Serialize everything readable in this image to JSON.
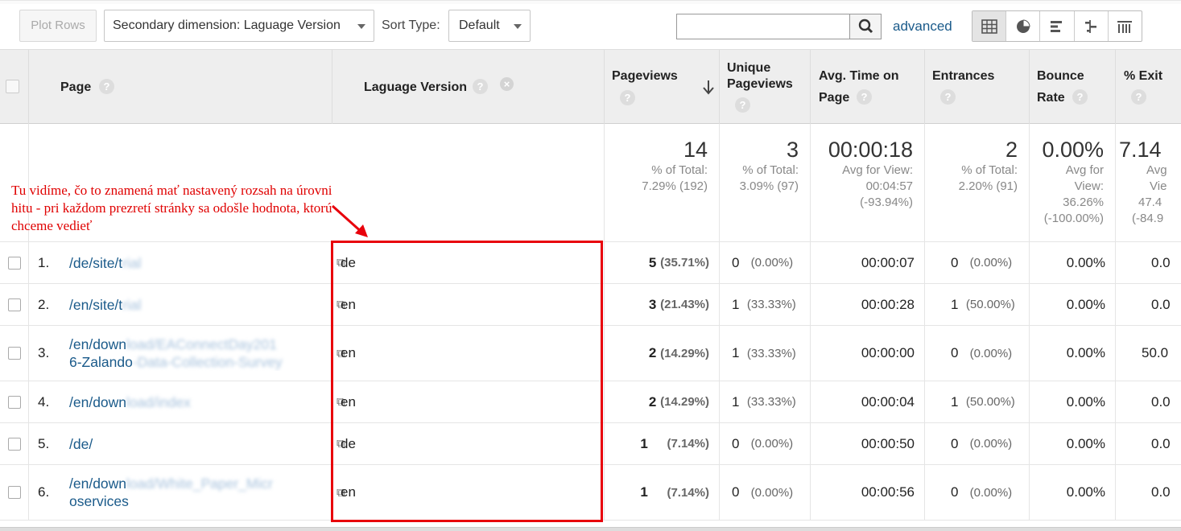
{
  "toolbar": {
    "plot_rows": "Plot Rows",
    "secondary_dimension": "Secondary dimension: Laguage Version",
    "sort_type_label": "Sort Type:",
    "sort_type_value": "Default",
    "search_value": "",
    "advanced": "advanced",
    "view_icons": [
      "table-grid-icon",
      "pie-chart-icon",
      "bar-performance-icon",
      "comparison-icon",
      "pivot-icon"
    ]
  },
  "columns": {
    "page": "Page",
    "language": "Laguage Version",
    "pageviews": "Pageviews",
    "unique_l1": "Unique",
    "unique_l2": "Pageviews",
    "avg_time_l1": "Avg. Time on",
    "avg_time_l2": "Page",
    "entrances": "Entrances",
    "bounce_l1": "Bounce",
    "bounce_l2": "Rate",
    "exit": "% Exit",
    "help": "?"
  },
  "totals": {
    "pageviews": {
      "value": "14",
      "l1": "% of Total:",
      "l2": "7.29% (192)"
    },
    "unique": {
      "value": "3",
      "l1": "% of Total:",
      "l2": "3.09% (97)"
    },
    "avg_time": {
      "value": "00:00:18",
      "l1": "Avg for View:",
      "l2": "00:04:57",
      "l3": "(-93.94%)"
    },
    "entrances": {
      "value": "2",
      "l1": "% of Total:",
      "l2": "2.20% (91)"
    },
    "bounce": {
      "value": "0.00%",
      "l1": "Avg for",
      "l2": "View:",
      "l3": "36.26%",
      "l4": "(-100.00%)"
    },
    "exit": {
      "value": "7.14",
      "l1": "Avg",
      "l2": "Vie",
      "l3": "47.4",
      "l4": "(-84.9"
    }
  },
  "annotation": "Tu vidíme, čo to znamená mať nastavený rozsah na úrovni hitu - pri každom prezretí stránky sa odošle hodnota, ktorú chceme vedieť",
  "rows": [
    {
      "num": "1.",
      "page_a": "/de/site/t",
      "page_b": "rial",
      "page_c": "",
      "lang": "de",
      "pv": "5",
      "pv_pct": "(35.71%)",
      "uniq": "0",
      "uniq_pct": "(0.00%)",
      "time": "00:00:07",
      "ent": "0",
      "ent_pct": "(0.00%)",
      "bounce": "0.00%",
      "exit": "0.0"
    },
    {
      "num": "2.",
      "page_a": "/en/site/t",
      "page_b": "rial",
      "page_c": "",
      "lang": "en",
      "pv": "3",
      "pv_pct": "(21.43%)",
      "uniq": "1",
      "uniq_pct": "(33.33%)",
      "time": "00:00:28",
      "ent": "1",
      "ent_pct": "(50.00%)",
      "bounce": "0.00%",
      "exit": "0.0"
    },
    {
      "num": "3.",
      "page_a": "/en/down",
      "page_b": "load/EAConnectDay201",
      "page_c": "6-Zalando",
      "page_d": "-Data-Collection-Survey",
      "lang": "en",
      "pv": "2",
      "pv_pct": "(14.29%)",
      "uniq": "1",
      "uniq_pct": "(33.33%)",
      "time": "00:00:00",
      "ent": "0",
      "ent_pct": "(0.00%)",
      "bounce": "0.00%",
      "exit": "50.0"
    },
    {
      "num": "4.",
      "page_a": "/en/down",
      "page_b": "load/index",
      "page_c": "",
      "lang": "en",
      "pv": "2",
      "pv_pct": "(14.29%)",
      "uniq": "1",
      "uniq_pct": "(33.33%)",
      "time": "00:00:04",
      "ent": "1",
      "ent_pct": "(50.00%)",
      "bounce": "0.00%",
      "exit": "0.0"
    },
    {
      "num": "5.",
      "page_a": "/de/",
      "page_b": "",
      "page_c": "",
      "lang": "de",
      "pv": "1",
      "pv_pct": "(7.14%)",
      "uniq": "0",
      "uniq_pct": "(0.00%)",
      "time": "00:00:50",
      "ent": "0",
      "ent_pct": "(0.00%)",
      "bounce": "0.00%",
      "exit": "0.0"
    },
    {
      "num": "6.",
      "page_a": "/en/down",
      "page_b": "load/White_Paper_Micr",
      "page_c": "oservices",
      "page_d": "",
      "lang": "en",
      "pv": "1",
      "pv_pct": "(7.14%)",
      "uniq": "0",
      "uniq_pct": "(0.00%)",
      "time": "00:00:56",
      "ent": "0",
      "ent_pct": "(0.00%)",
      "bounce": "0.00%",
      "exit": "0.0"
    }
  ],
  "colors": {
    "link": "#1a5a8a",
    "annotation": "#e00000",
    "highlight_box": "#e8000b"
  }
}
